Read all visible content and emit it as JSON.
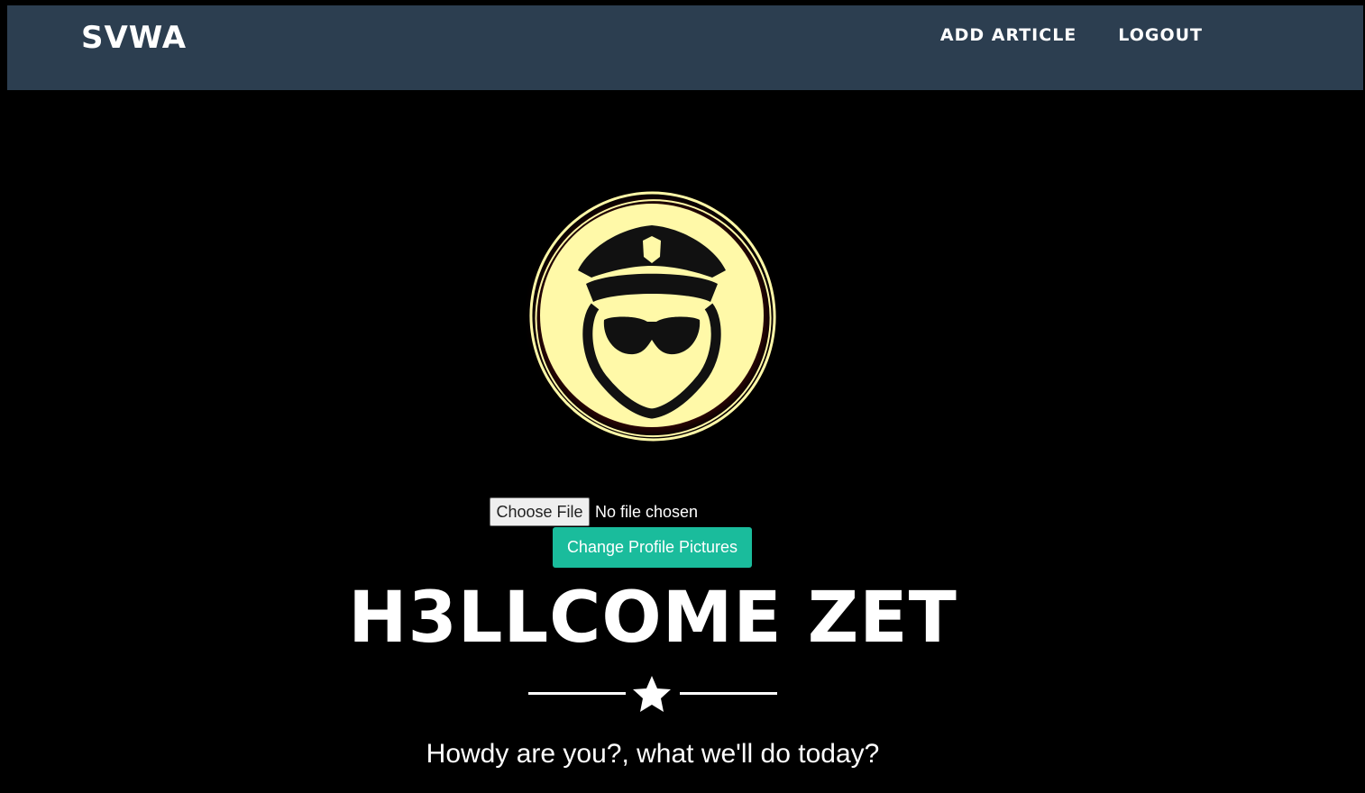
{
  "navbar": {
    "brand": "SVWA",
    "links": [
      "ADD ARTICLE",
      "LOGOUT"
    ]
  },
  "profile": {
    "avatar_icon": "police-officer-icon",
    "choose_file_label": "Choose File",
    "file_status": "No file chosen",
    "change_button_label": "Change Profile Pictures"
  },
  "masthead": {
    "heading": "H3LLCOME ZET",
    "divider_icon": "star-icon",
    "tagline": "Howdy are you?, what we'll do today?"
  },
  "colors": {
    "navbar_bg": "#2c3e50",
    "accent": "#1abc9c",
    "page_bg": "#000000",
    "avatar_fill": "#fff9a8"
  }
}
